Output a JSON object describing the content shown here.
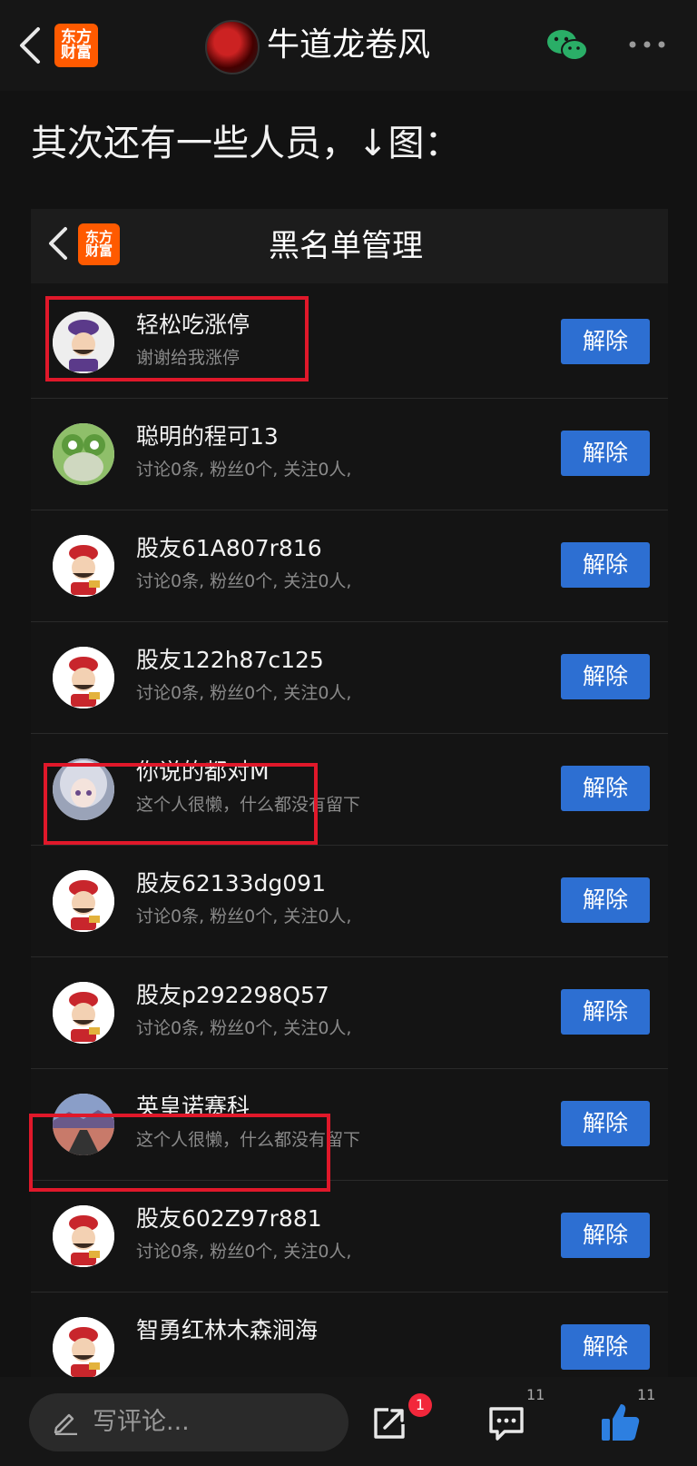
{
  "header": {
    "author": "牛道龙卷风",
    "logo": [
      "东方",
      "财富"
    ]
  },
  "post": {
    "text": "其次还有一些人员，↓图："
  },
  "screenshot": {
    "title": "黑名单管理",
    "logo": [
      "东方",
      "财富"
    ],
    "unblock_label": "解除",
    "users": [
      {
        "name": "轻松吃涨停",
        "sub": "谢谢给我涨停",
        "avatar": "mascot-purple-avatar",
        "highlighted": true
      },
      {
        "name": "聪明的程可13",
        "sub": "讨论0条, 粉丝0个, 关注0人,",
        "avatar": "frog-avatar",
        "highlighted": false
      },
      {
        "name": "股友61A807r816",
        "sub": "讨论0条, 粉丝0个, 关注0人,",
        "avatar": "default-mascot-avatar",
        "highlighted": false
      },
      {
        "name": "股友122h87c125",
        "sub": "讨论0条, 粉丝0个, 关注0人,",
        "avatar": "default-mascot-avatar",
        "highlighted": false
      },
      {
        "name": "你说的都对M",
        "sub": "这个人很懒，什么都没有留下",
        "avatar": "anime-girl-avatar",
        "highlighted": true
      },
      {
        "name": "股友62133dg091",
        "sub": "讨论0条, 粉丝0个, 关注0人,",
        "avatar": "default-mascot-avatar",
        "highlighted": false
      },
      {
        "name": "股友p292298Q57",
        "sub": "讨论0条, 粉丝0个, 关注0人,",
        "avatar": "default-mascot-avatar",
        "highlighted": false
      },
      {
        "name": "英皇诺赛科",
        "sub": "这个人很懒，什么都没有留下",
        "avatar": "road-landscape-avatar",
        "highlighted": true
      },
      {
        "name": "股友602Z97r881",
        "sub": "讨论0条, 粉丝0个, 关注0人,",
        "avatar": "default-mascot-avatar",
        "highlighted": false
      },
      {
        "name": "智勇红林木森涧海",
        "sub": "",
        "avatar": "default-mascot-avatar",
        "highlighted": false
      }
    ]
  },
  "bottom": {
    "comment_placeholder": "写评论...",
    "share_badge": "1",
    "comment_count": "11",
    "like_count": "11"
  },
  "colors": {
    "accent_blue": "#2d6fd2",
    "highlight_red": "#e0182a",
    "brand_orange": "#ff5a00",
    "background": "#121212"
  }
}
